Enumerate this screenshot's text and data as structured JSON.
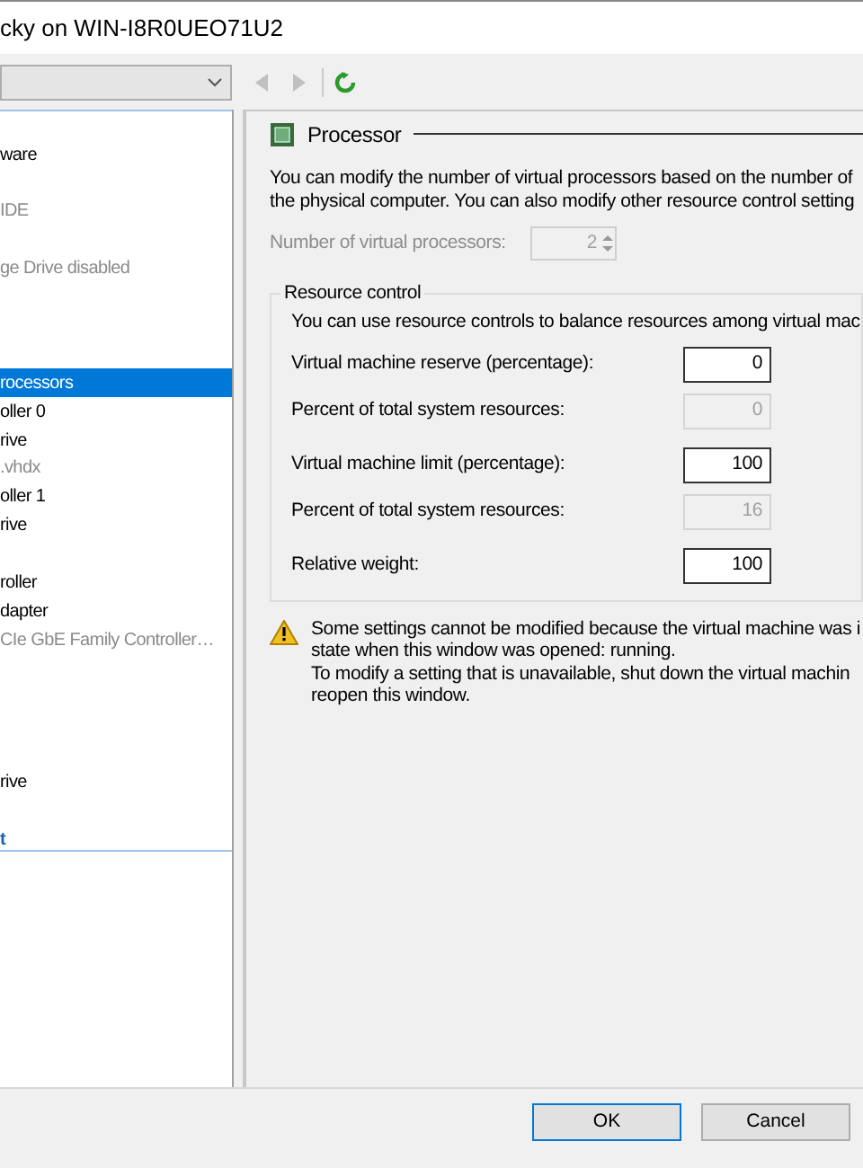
{
  "window": {
    "title": "cky on WIN-I8R0UEO71U2"
  },
  "tree": {
    "items": [
      {
        "label": "ware",
        "dimmed": false,
        "selected": false,
        "bold": false
      },
      {
        "label": "IDE",
        "dimmed": true,
        "selected": false,
        "bold": false
      },
      {
        "label": "ge Drive disabled",
        "dimmed": true,
        "selected": false,
        "bold": false
      },
      {
        "label": "rocessors",
        "dimmed": false,
        "selected": true,
        "bold": false
      },
      {
        "label": "oller 0",
        "dimmed": false,
        "selected": false,
        "bold": false
      },
      {
        "label": "rive",
        "dimmed": false,
        "selected": false,
        "bold": false
      },
      {
        "label": ".vhdx",
        "dimmed": true,
        "selected": false,
        "bold": false
      },
      {
        "label": "oller 1",
        "dimmed": false,
        "selected": false,
        "bold": false
      },
      {
        "label": "rive",
        "dimmed": false,
        "selected": false,
        "bold": false
      },
      {
        "label": "roller",
        "dimmed": false,
        "selected": false,
        "bold": false
      },
      {
        "label": "dapter",
        "dimmed": false,
        "selected": false,
        "bold": false
      },
      {
        "label": "CIe GbE Family Controller…",
        "dimmed": true,
        "selected": false,
        "bold": false
      },
      {
        "label": "rive",
        "dimmed": false,
        "selected": false,
        "bold": false
      },
      {
        "label": "t",
        "dimmed": false,
        "selected": false,
        "bold": true
      }
    ]
  },
  "section": {
    "title": "Processor",
    "description": [
      "You can modify the number of virtual processors based on the number of",
      "the physical computer. You can also modify other resource control setting"
    ],
    "processors": {
      "label": "Number of virtual processors:",
      "value": "2",
      "disabled": true
    },
    "resource_control": {
      "title": "Resource control",
      "description": "You can use resource controls to balance resources among virtual mac",
      "fields": [
        {
          "label": "Virtual machine reserve (percentage):",
          "value": "0",
          "disabled": false
        },
        {
          "label": "Percent of total system resources:",
          "value": "0",
          "disabled": true
        },
        {
          "label": "Virtual machine limit (percentage):",
          "value": "100",
          "disabled": false
        },
        {
          "label": "Percent of total system resources:",
          "value": "16",
          "disabled": true
        },
        {
          "label": "Relative weight:",
          "value": "100",
          "disabled": false
        }
      ]
    },
    "warning": [
      "Some settings cannot be modified because the virtual machine was i",
      "state when this window was opened: running.",
      "To modify a setting that is unavailable, shut down the virtual machin",
      "reopen this window."
    ]
  },
  "buttons": [
    {
      "label": "OK",
      "default": true
    },
    {
      "label": "Cancel",
      "default": false
    }
  ]
}
